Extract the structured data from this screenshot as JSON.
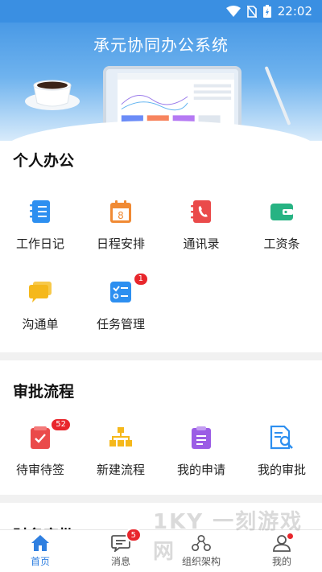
{
  "status_bar": {
    "time": "22:02"
  },
  "app": {
    "title": "承元协同办公系统"
  },
  "sections": [
    {
      "title": "个人办公",
      "items": [
        {
          "label": "工作日记",
          "icon": "notebook-icon",
          "color": "#2d8ff0"
        },
        {
          "label": "日程安排",
          "icon": "calendar-icon",
          "color": "#f08a34"
        },
        {
          "label": "通讯录",
          "icon": "phonebook-icon",
          "color": "#ea4a4a"
        },
        {
          "label": "工资条",
          "icon": "wallet-icon",
          "color": "#27b383"
        },
        {
          "label": "沟通单",
          "icon": "chat-bubbles-icon",
          "color": "#f5b81b"
        },
        {
          "label": "任务管理",
          "icon": "task-list-icon",
          "color": "#2d8ff0",
          "badge": "1"
        }
      ]
    },
    {
      "title": "审批流程",
      "items": [
        {
          "label": "待审待签",
          "icon": "pending-approval-icon",
          "color": "#ea4a4a",
          "badge": "52"
        },
        {
          "label": "新建流程",
          "icon": "flowchart-icon",
          "color": "#f5b81b"
        },
        {
          "label": "我的申请",
          "icon": "clipboard-icon",
          "color": "#9b5de5"
        },
        {
          "label": "我的审批",
          "icon": "document-search-icon",
          "color": "#2d8ff0"
        }
      ]
    },
    {
      "title": "财务审批"
    }
  ],
  "tabbar": [
    {
      "label": "首页",
      "icon": "home-icon",
      "active": true
    },
    {
      "label": "消息",
      "icon": "message-icon",
      "badge": "5"
    },
    {
      "label": "组织架构",
      "icon": "org-structure-icon"
    },
    {
      "label": "我的",
      "icon": "profile-icon",
      "dot": true
    }
  ],
  "watermark": "1KY 一刻游戏网",
  "colors": {
    "accent": "#2f7fe0",
    "badge": "#e8262c",
    "header": "#3a8fe2"
  }
}
